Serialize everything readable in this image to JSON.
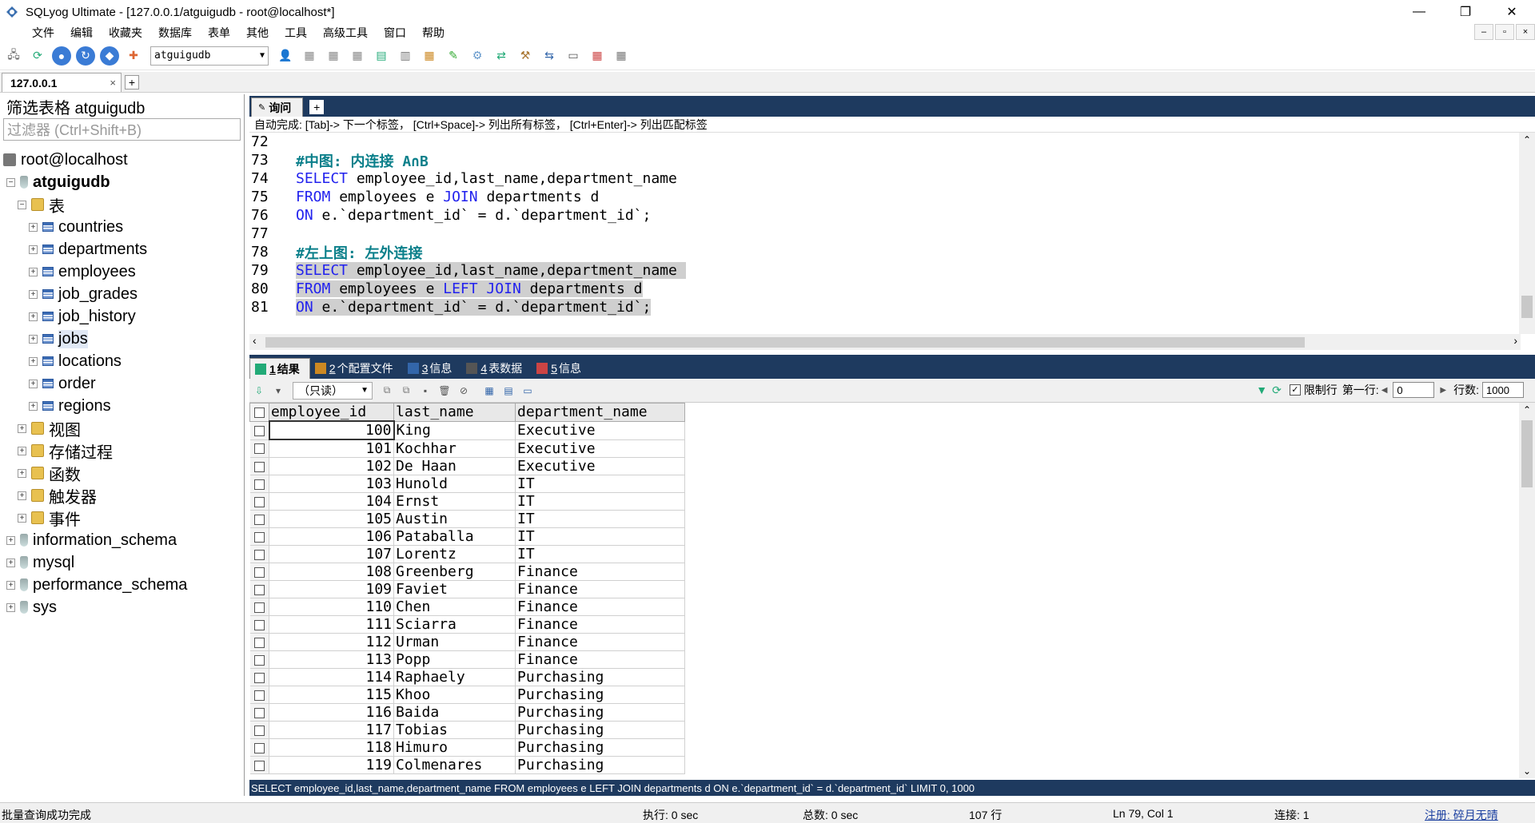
{
  "window": {
    "title": "SQLyog Ultimate - [127.0.0.1/atguigudb - root@localhost*]",
    "min": "—",
    "max": "❐",
    "close": "✕"
  },
  "menu": [
    "文件",
    "编辑",
    "收藏夹",
    "数据库",
    "表单",
    "其他",
    "工具",
    "高级工具",
    "窗口",
    "帮助"
  ],
  "toolbar": {
    "db_select": "atguigudb"
  },
  "connection_tab": {
    "label": "127.0.0.1",
    "close": "×",
    "add": "+"
  },
  "left": {
    "filter_label": "筛选表格 atguigudb",
    "filter_placeholder": "过滤器 (Ctrl+Shift+B)",
    "tree": {
      "server": "root@localhost",
      "db": "atguigudb",
      "tables_folder": "表",
      "tables": [
        "countries",
        "departments",
        "employees",
        "job_grades",
        "job_history",
        "jobs",
        "locations",
        "order",
        "regions"
      ],
      "folders": [
        "视图",
        "存储过程",
        "函数",
        "触发器",
        "事件"
      ],
      "other_dbs": [
        "information_schema",
        "mysql",
        "performance_schema",
        "sys"
      ]
    }
  },
  "query_tab": {
    "label": "询问",
    "add": "+"
  },
  "autocomplete": "自动完成: [Tab]-> 下一个标签， [Ctrl+Space]-> 列出所有标签， [Ctrl+Enter]-> 列出匹配标签",
  "editor_lines": [
    {
      "n": "72",
      "parts": []
    },
    {
      "n": "73",
      "parts": [
        {
          "t": "#中图: 内连接 A∩B",
          "c": "cm"
        }
      ]
    },
    {
      "n": "74",
      "parts": [
        {
          "t": "SELECT",
          "c": "kw"
        },
        {
          "t": " employee_id,last_name,department_name",
          "c": "txt"
        }
      ]
    },
    {
      "n": "75",
      "parts": [
        {
          "t": "FROM",
          "c": "kw"
        },
        {
          "t": " employees e ",
          "c": "txt"
        },
        {
          "t": "JOIN",
          "c": "kw"
        },
        {
          "t": " departments d",
          "c": "txt"
        }
      ]
    },
    {
      "n": "76",
      "parts": [
        {
          "t": "ON",
          "c": "kw"
        },
        {
          "t": " e.`department_id` = d.`department_id`;",
          "c": "txt"
        }
      ]
    },
    {
      "n": "77",
      "parts": []
    },
    {
      "n": "78",
      "parts": [
        {
          "t": "#左上图: 左外连接",
          "c": "cm"
        }
      ]
    },
    {
      "n": "79",
      "hl": true,
      "parts": [
        {
          "t": "SELECT",
          "c": "kw"
        },
        {
          "t": " employee_id,last_name,department_name ",
          "c": "txt"
        }
      ]
    },
    {
      "n": "80",
      "hl": true,
      "parts": [
        {
          "t": "FROM",
          "c": "kw"
        },
        {
          "t": " employees e ",
          "c": "txt"
        },
        {
          "t": "LEFT JOIN",
          "c": "kw"
        },
        {
          "t": " departments d",
          "c": "txt"
        }
      ]
    },
    {
      "n": "81",
      "hl": true,
      "parts": [
        {
          "t": "ON",
          "c": "kw"
        },
        {
          "t": " e.`department_id` = d.`department_id`;",
          "c": "txt"
        }
      ]
    }
  ],
  "result_tabs": [
    {
      "num": "1",
      "label": " 结果",
      "active": true
    },
    {
      "num": "2",
      "label": " 个配置文件",
      "active": false
    },
    {
      "num": "3",
      "label": " 信息",
      "active": false
    },
    {
      "num": "4",
      "label": " 表数据",
      "active": false
    },
    {
      "num": "5",
      "label": " 信息",
      "active": false
    }
  ],
  "result_toolbar": {
    "mode": "（只读）",
    "limit_label": "限制行",
    "first_row_label": "第一行:",
    "first_row": "0",
    "rows_label": "行数:",
    "rows": "1000"
  },
  "grid": {
    "columns": [
      "employee_id",
      "last_name",
      "department_name"
    ],
    "rows": [
      [
        "100",
        "King",
        "Executive"
      ],
      [
        "101",
        "Kochhar",
        "Executive"
      ],
      [
        "102",
        "De Haan",
        "Executive"
      ],
      [
        "103",
        "Hunold",
        "IT"
      ],
      [
        "104",
        "Ernst",
        "IT"
      ],
      [
        "105",
        "Austin",
        "IT"
      ],
      [
        "106",
        "Pataballa",
        "IT"
      ],
      [
        "107",
        "Lorentz",
        "IT"
      ],
      [
        "108",
        "Greenberg",
        "Finance"
      ],
      [
        "109",
        "Faviet",
        "Finance"
      ],
      [
        "110",
        "Chen",
        "Finance"
      ],
      [
        "111",
        "Sciarra",
        "Finance"
      ],
      [
        "112",
        "Urman",
        "Finance"
      ],
      [
        "113",
        "Popp",
        "Finance"
      ],
      [
        "114",
        "Raphaely",
        "Purchasing"
      ],
      [
        "115",
        "Khoo",
        "Purchasing"
      ],
      [
        "116",
        "Baida",
        "Purchasing"
      ],
      [
        "117",
        "Tobias",
        "Purchasing"
      ],
      [
        "118",
        "Himuro",
        "Purchasing"
      ],
      [
        "119",
        "Colmenares",
        "Purchasing"
      ]
    ]
  },
  "sql_status": "SELECT employee_id,last_name,department_name FROM employees e LEFT JOIN departments d ON e.`department_id` = d.`department_id` LIMIT 0, 1000",
  "status": {
    "message": "批量查询成功完成",
    "exec": "执行: 0 sec",
    "total": "总数: 0 sec",
    "rows": "107 行",
    "position": "Ln 79, Col 1",
    "connections": "连接: 1",
    "register": "注册: 碎月无晴"
  }
}
